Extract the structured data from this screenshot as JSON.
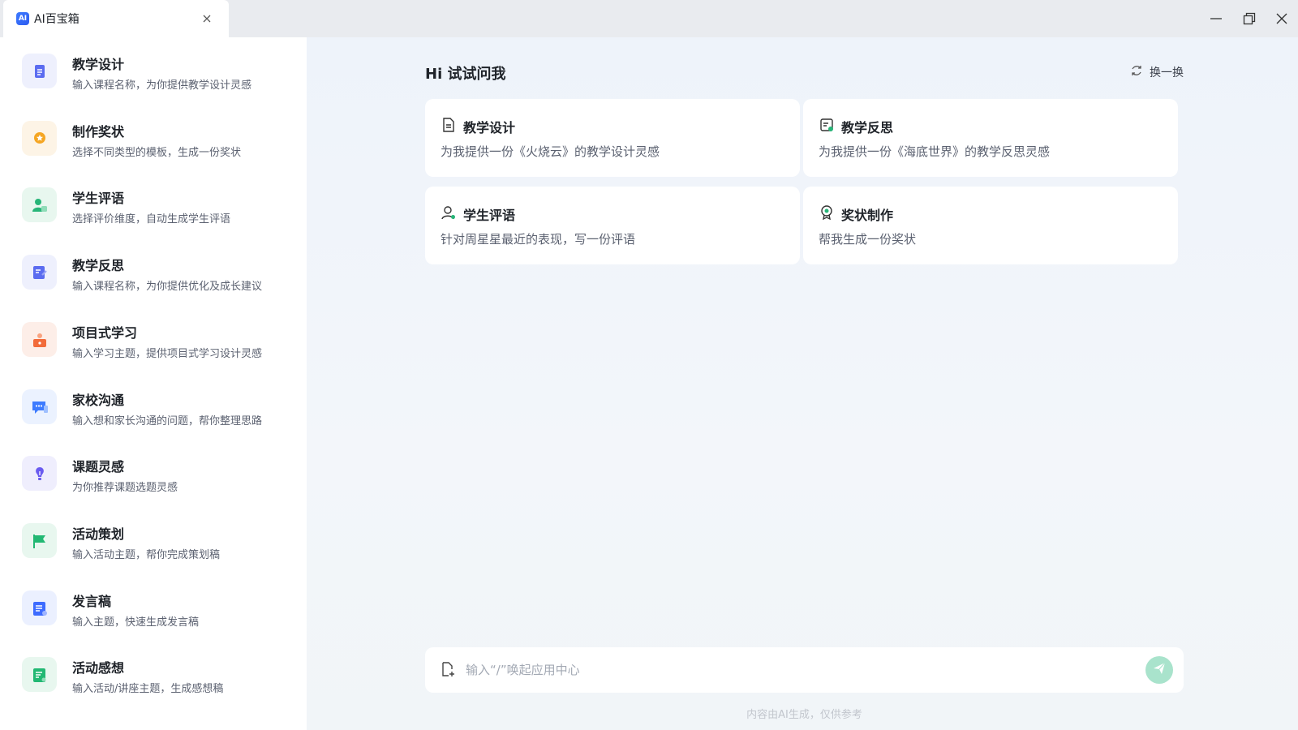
{
  "window": {
    "tab_title": "AI百宝箱",
    "logo_text": "AI"
  },
  "sidebar": {
    "items": [
      {
        "title": "教学设计",
        "desc": "输入课程名称，为你提供教学设计灵感",
        "icon": "document-icon",
        "color": "#5b6cf0",
        "bg": "#eef0fd"
      },
      {
        "title": "制作奖状",
        "desc": "选择不同类型的模板，生成一份奖状",
        "icon": "award-icon",
        "color": "#f5a623",
        "bg": "#fdf4e6"
      },
      {
        "title": "学生评语",
        "desc": "选择评价维度，自动生成学生评语",
        "icon": "student-icon",
        "color": "#27b578",
        "bg": "#e8f7ef"
      },
      {
        "title": "教学反思",
        "desc": "输入课程名称，为你提供优化及成长建议",
        "icon": "reflection-icon",
        "color": "#5b6cf0",
        "bg": "#eef0fd"
      },
      {
        "title": "项目式学习",
        "desc": "输入学习主题，提供项目式学习设计灵感",
        "icon": "project-icon",
        "color": "#f26b3a",
        "bg": "#fdeee8"
      },
      {
        "title": "家校沟通",
        "desc": "输入想和家长沟通的问题，帮你整理思路",
        "icon": "chat-bubble-icon",
        "color": "#3d7bff",
        "bg": "#ebf2ff"
      },
      {
        "title": "课题灵感",
        "desc": "为你推荐课题选题灵感",
        "icon": "lightbulb-icon",
        "color": "#6a5bf0",
        "bg": "#efeefd"
      },
      {
        "title": "活动策划",
        "desc": "输入活动主题，帮你完成策划稿",
        "icon": "flag-icon",
        "color": "#22b873",
        "bg": "#e8f7ef"
      },
      {
        "title": "发言稿",
        "desc": "输入主题，快速生成发言稿",
        "icon": "speech-icon",
        "color": "#3d6bff",
        "bg": "#ebf0ff"
      },
      {
        "title": "活动感想",
        "desc": "输入活动/讲座主题，生成感想稿",
        "icon": "notes-icon",
        "color": "#22b873",
        "bg": "#e8f7ef"
      }
    ]
  },
  "main": {
    "greeting": "Hi 试试问我",
    "refresh_label": "换一换",
    "cards": [
      {
        "title": "教学设计",
        "desc": "为我提供一份《火烧云》的教学设计灵感",
        "icon": "document-icon"
      },
      {
        "title": "教学反思",
        "desc": "为我提供一份《海底世界》的教学反思灵感",
        "icon": "reflection-icon"
      },
      {
        "title": "学生评语",
        "desc": "针对周星星最近的表现，写一份评语",
        "icon": "student-icon"
      },
      {
        "title": "奖状制作",
        "desc": "帮我生成一份奖状",
        "icon": "award-icon"
      }
    ],
    "input": {
      "placeholder": "输入“/”唤起应用中心",
      "value": ""
    },
    "disclaimer": "内容由AI生成，仅供参考"
  },
  "colors": {
    "accent_green": "#a9e3cc",
    "sidebar_bg": "#ffffff",
    "main_bg": "#eef3fa"
  }
}
